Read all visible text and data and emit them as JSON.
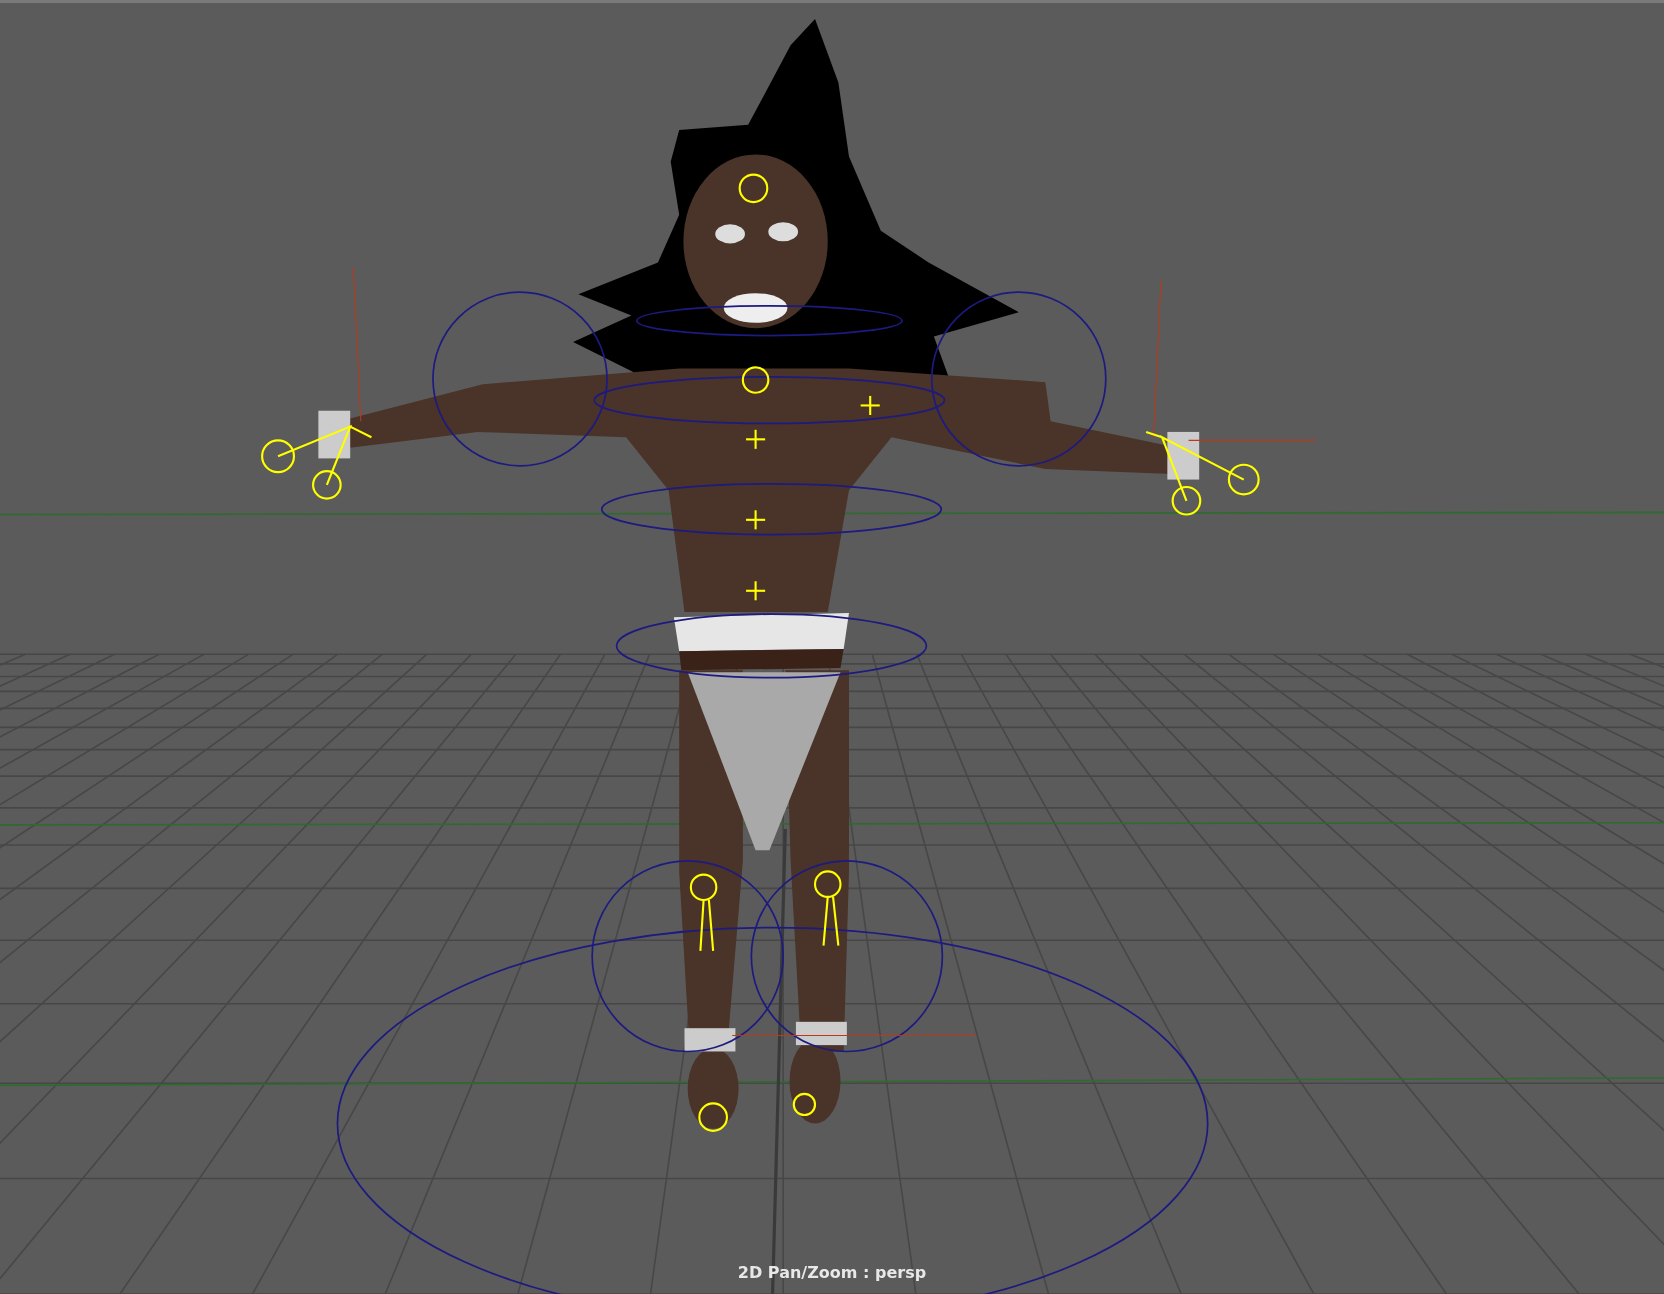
{
  "viewport": {
    "status_label": "2D Pan/Zoom : persp"
  }
}
